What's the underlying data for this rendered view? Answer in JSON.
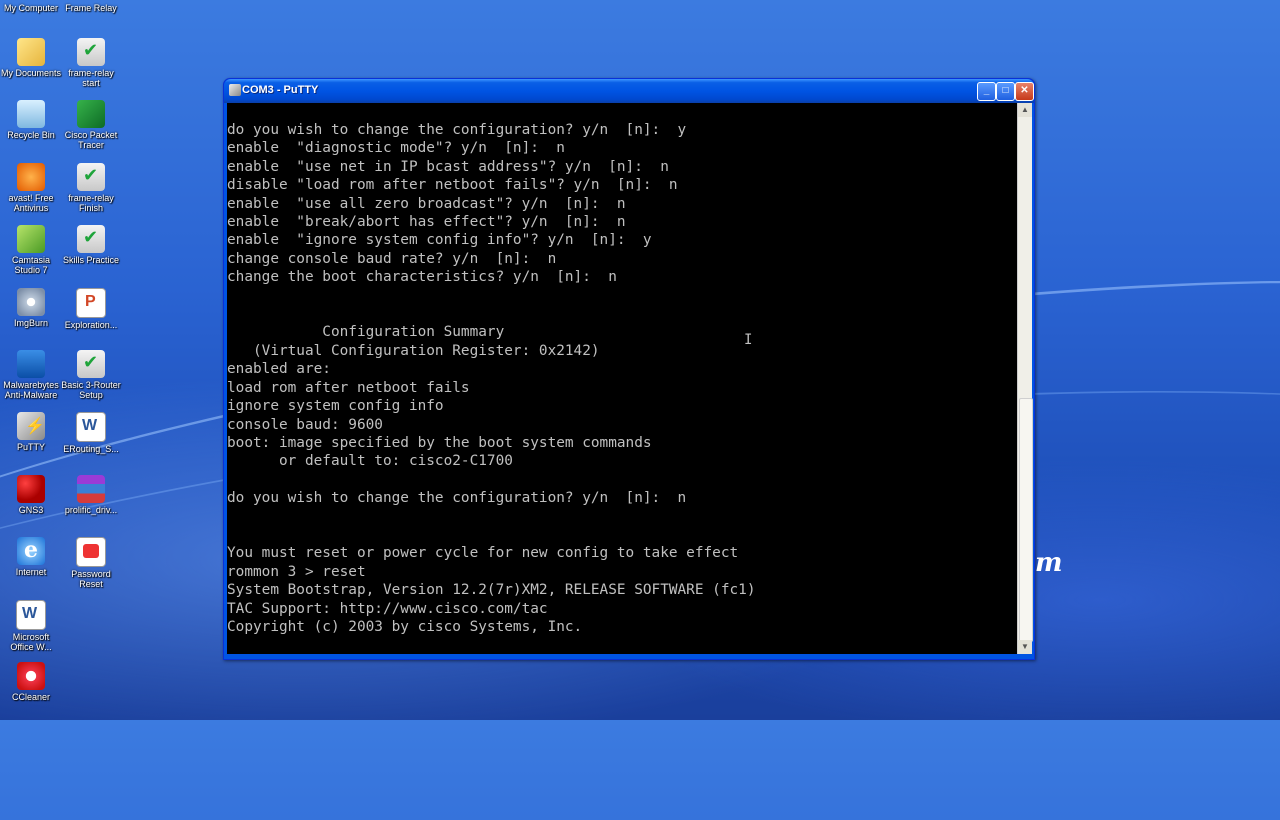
{
  "desktop": {
    "top_labels": [
      "My Computer",
      "Frame Relay"
    ],
    "icons_col1": [
      {
        "label": "My Documents",
        "icon": "folder-icon"
      },
      {
        "label": "Recycle Bin",
        "icon": "recycle-bin-icon"
      },
      {
        "label": "avast! Free Antivirus",
        "icon": "avast-icon"
      },
      {
        "label": "Camtasia Studio 7",
        "icon": "camtasia-icon"
      },
      {
        "label": "ImgBurn",
        "icon": "disc-icon"
      },
      {
        "label": "Malwarebytes Anti-Malware",
        "icon": "malwarebytes-icon"
      },
      {
        "label": "PuTTY",
        "icon": "putty-icon"
      },
      {
        "label": "GNS3",
        "icon": "gns3-icon"
      },
      {
        "label": "Internet",
        "icon": "internet-explorer-icon"
      },
      {
        "label": "Microsoft Office W...",
        "icon": "word-icon"
      },
      {
        "label": "CCleaner",
        "icon": "ccleaner-icon"
      }
    ],
    "icons_col2": [
      {
        "label": "frame-relay start",
        "icon": "packet-file-icon"
      },
      {
        "label": "Cisco Packet Tracer",
        "icon": "packet-tracer-icon"
      },
      {
        "label": "frame-relay Finish",
        "icon": "packet-file-icon"
      },
      {
        "label": "Skills Practice",
        "icon": "packet-file-icon"
      },
      {
        "label": "Exploration...",
        "icon": "powerpoint-icon"
      },
      {
        "label": "Basic 3-Router Setup",
        "icon": "packet-file-icon"
      },
      {
        "label": "ERouting_S...",
        "icon": "word-icon"
      },
      {
        "label": "prolific_driv...",
        "icon": "winrar-icon"
      },
      {
        "label": "Password Reset",
        "icon": "pdf-icon"
      }
    ]
  },
  "window": {
    "title": "COM3 - PuTTY",
    "min_label": "_",
    "max_label": "□",
    "close_label": "✕"
  },
  "terminal": {
    "lines": [
      "do you wish to change the configuration? y/n  [n]:  y",
      "enable  \"diagnostic mode\"? y/n  [n]:  n",
      "enable  \"use net in IP bcast address\"? y/n  [n]:  n",
      "disable \"load rom after netboot fails\"? y/n  [n]:  n",
      "enable  \"use all zero broadcast\"? y/n  [n]:  n",
      "enable  \"break/abort has effect\"? y/n  [n]:  n",
      "enable  \"ignore system config info\"? y/n  [n]:  y",
      "change console baud rate? y/n  [n]:  n",
      "change the boot characteristics? y/n  [n]:  n",
      "",
      "",
      "           Configuration Summary",
      "   (Virtual Configuration Register: 0x2142)",
      "enabled are:",
      "load rom after netboot fails",
      "ignore system config info",
      "console baud: 9600",
      "boot: image specified by the boot system commands",
      "      or default to: cisco2-C1700",
      "",
      "do you wish to change the configuration? y/n  [n]:  n",
      "",
      "",
      "You must reset or power cycle for new config to take effect",
      "rommon 3 > reset",
      "System Bootstrap, Version 12.2(7r)XM2, RELEASE SOFTWARE (fc1)",
      "TAC Support: http://www.cisco.com/tac",
      "Copyright (c) 2003 by cisco Systems, Inc."
    ]
  },
  "watermark": "m",
  "colors": {
    "cursor": "#00ff00",
    "terminal_bg": "#000000",
    "terminal_fg": "#c0c0c0"
  }
}
